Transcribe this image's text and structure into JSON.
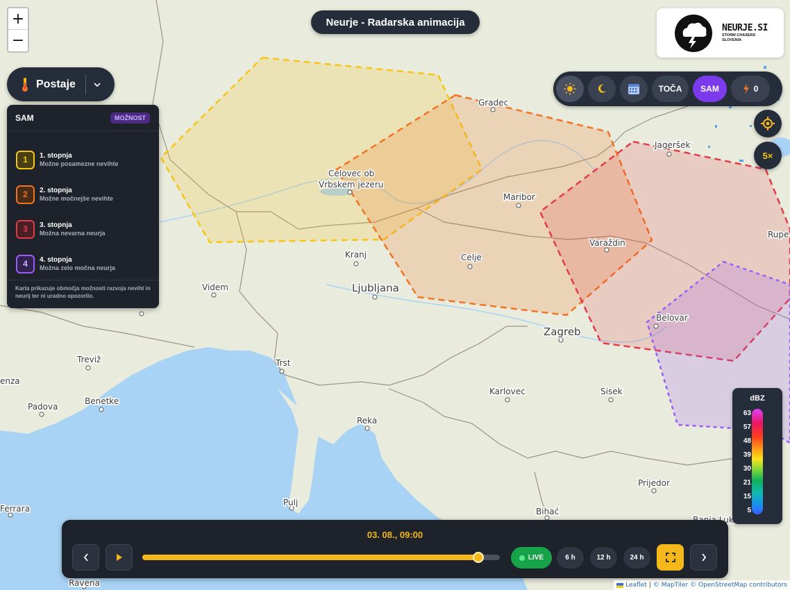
{
  "title": "Neurje - Radarska animacija",
  "zoom": {
    "in_label": "+",
    "out_label": "−"
  },
  "logo": {
    "name": "NEURJE.SI",
    "tagline_1": "STORM CHASERS",
    "tagline_2": "SLOVENIA"
  },
  "stations": {
    "label": "Postaje",
    "icon": "thermometer-icon"
  },
  "legend": {
    "title": "SAM",
    "badge": "MOŽNOST",
    "levels": [
      {
        "num": "1",
        "name": "1. stopnja",
        "desc": "Možne posamezne nevihte",
        "color": "#f5c518"
      },
      {
        "num": "2",
        "name": "2. stopnja",
        "desc": "Možne močnejše nevihte",
        "color": "#f27324"
      },
      {
        "num": "3",
        "name": "3. stopnja",
        "desc": "Možna nevarna neurja",
        "color": "#e23b4a"
      },
      {
        "num": "4",
        "name": "4. stopnja",
        "desc": "Možna zelo močna neurja",
        "color": "#9b5cf6"
      }
    ],
    "note": "Karta prikazuje območja možnosti razvoja neviht in neurij ter ni uradno opozorilo."
  },
  "toolbar": {
    "buttons": [
      {
        "icon": "sun-icon"
      },
      {
        "icon": "moon-icon"
      },
      {
        "icon": "calendar-icon"
      },
      {
        "label": "TOČA"
      },
      {
        "label": "SAM",
        "active": true
      },
      {
        "icon": "lightning-icon",
        "count": "0"
      }
    ]
  },
  "side_buttons": {
    "locate_icon": "crosshair-icon",
    "speed_label": "5×"
  },
  "radar_scale": {
    "title": "dBZ",
    "ticks": [
      "63",
      "57",
      "48",
      "39",
      "30",
      "21",
      "15",
      "5"
    ],
    "colors": [
      "#e040fb",
      "#e8175d",
      "#ff3b1f",
      "#ff9b18",
      "#f6e51e",
      "#7ad63a",
      "#10b05b",
      "#0fb9b1",
      "#1a8bf2",
      "#3b5bff"
    ]
  },
  "timeline": {
    "current_time": "03. 08., 09:00",
    "progress": 0.94,
    "live_label": "LIVE",
    "ranges": [
      "6 h",
      "12 h",
      "24 h"
    ]
  },
  "map": {
    "cities": [
      {
        "name": "Gradec"
      },
      {
        "name": "Celovec ob"
      },
      {
        "name": "Vrbskem jezeru"
      },
      {
        "name": "Maribor"
      },
      {
        "name": "Jageršek"
      },
      {
        "name": "Varaždin"
      },
      {
        "name": "Kranj"
      },
      {
        "name": "Celje"
      },
      {
        "name": "Videm"
      },
      {
        "name": "Ljubljana"
      },
      {
        "name": "Zagreb"
      },
      {
        "name": "Belovar"
      },
      {
        "name": "Treviž"
      },
      {
        "name": "Trst"
      },
      {
        "name": "Benetke"
      },
      {
        "name": "Padova"
      },
      {
        "name": "Karlovec"
      },
      {
        "name": "Sisek"
      },
      {
        "name": "Reka"
      },
      {
        "name": "Prijedor"
      },
      {
        "name": "Pulj"
      },
      {
        "name": "Bihać"
      },
      {
        "name": "Ravena"
      },
      {
        "name": "Ferrara"
      },
      {
        "name": "enza"
      },
      {
        "name": "Rupe"
      },
      {
        "name": "Banja Luka"
      }
    ],
    "risk_zones": [
      {
        "level": 1,
        "color": "#f5c518"
      },
      {
        "level": 2,
        "color": "#f27324"
      },
      {
        "level": 3,
        "color": "#e23b4a"
      },
      {
        "level": 4,
        "color": "#9b5cf6"
      }
    ],
    "water_color": "#a9d3f5",
    "land_color": "#e9ecdc"
  },
  "attribution": {
    "leaflet": "Leaflet",
    "maptiler": "© MapTiler",
    "osm": "© OpenStreetMap contributors"
  }
}
